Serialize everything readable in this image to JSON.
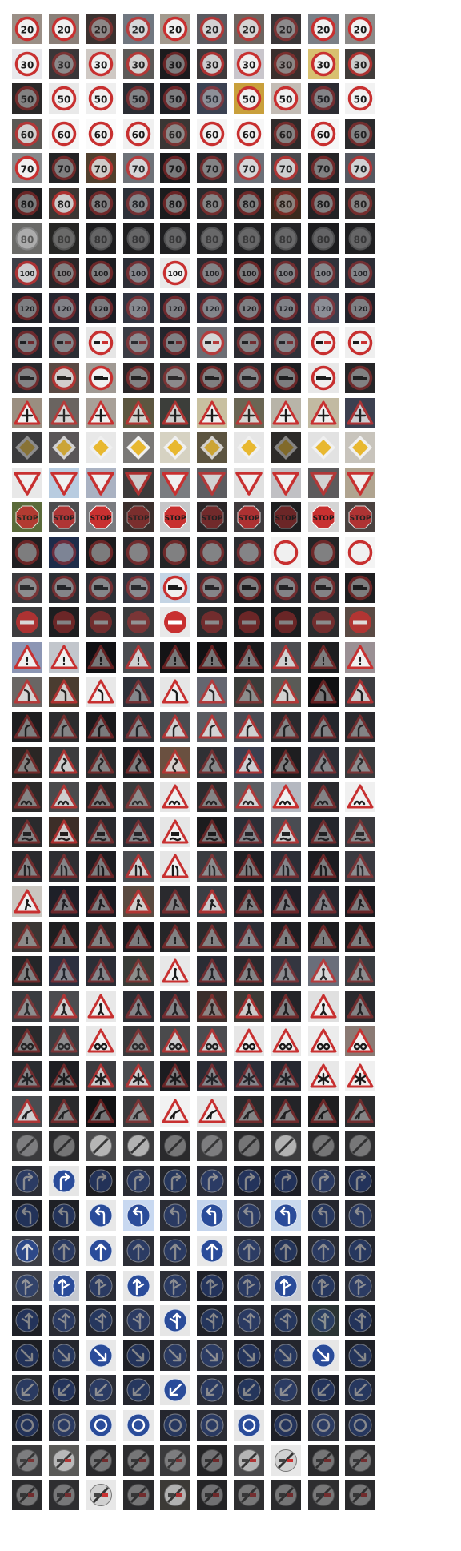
{
  "grid": {
    "columns": 10,
    "rows": [
      {
        "class": "speed-limit-20",
        "shape": "circle-red",
        "symbol": "20",
        "bgs": [
          "#9a8f86",
          "#8a7f78",
          "#3b3230",
          "#707780",
          "#a39a8e",
          "#5a5a60",
          "#6d6560",
          "#3a3638",
          "#7a7f86",
          "#8c8a88"
        ]
      },
      {
        "class": "speed-limit-30",
        "shape": "circle-red",
        "symbol": "30",
        "bgs": [
          "#e8e8ec",
          "#3a3638",
          "#cfc9c4",
          "#5c5a58",
          "#1c1b1d",
          "#3e3a3c",
          "#c9c6cc",
          "#3a2e2c",
          "#d8c070",
          "#403c3a"
        ]
      },
      {
        "class": "speed-limit-50",
        "shape": "circle-red",
        "symbol": "50",
        "bgs": [
          "#2a2828",
          "#e9e9e9",
          "#efefef",
          "#2a2d33",
          "#1e1f24",
          "#3b4252",
          "#c9a03c",
          "#c3bcb5",
          "#2c2c32",
          "#f2f2f2"
        ]
      },
      {
        "class": "speed-limit-60",
        "shape": "circle-red",
        "symbol": "60",
        "bgs": [
          "#5a5854",
          "#f5f5f5",
          "#fafafa",
          "#f0f0f0",
          "#3a3634",
          "#f4f4f4",
          "#f7f7f7",
          "#2e2a2a",
          "#f6f6f6",
          "#2a2a2c"
        ]
      },
      {
        "class": "speed-limit-70",
        "shape": "circle-red",
        "symbol": "70",
        "bgs": [
          "#888a8c",
          "#242426",
          "#51402e",
          "#6e7278",
          "#1a1a1c",
          "#2a2a2e",
          "#6c7078",
          "#4a4a4e",
          "#262628",
          "#555860"
        ]
      },
      {
        "class": "speed-limit-80",
        "shape": "circle-red",
        "symbol": "80",
        "bgs": [
          "#1d1d1f",
          "#3c3633",
          "#262325",
          "#2c3038",
          "#1b1b1d",
          "#2b2b2e",
          "#232325",
          "#3a2a1e",
          "#222224",
          "#2f2c2c"
        ]
      },
      {
        "class": "end-speed-limit-80",
        "shape": "circle-gray",
        "symbol": "80",
        "bgs": [
          "#6a6a68",
          "#262624",
          "#1d1d1f",
          "#1e1e20",
          "#1f1f21",
          "#222224",
          "#202022",
          "#232325",
          "#1c1c1e",
          "#1f1f21"
        ]
      },
      {
        "class": "speed-limit-100",
        "shape": "circle-red",
        "symbol": "100",
        "bgs": [
          "#3c3e46",
          "#2a2628",
          "#1e1e22",
          "#2c2e36",
          "#e9e9e9",
          "#2a2a30",
          "#1d1d21",
          "#2a2a30",
          "#30323a",
          "#2c2d35"
        ]
      },
      {
        "class": "speed-limit-120",
        "shape": "circle-red",
        "symbol": "120",
        "bgs": [
          "#1f2026",
          "#262630",
          "#1c1d24",
          "#323642",
          "#24252d",
          "#2a2d38",
          "#202128",
          "#252631",
          "#3a3e4c",
          "#22232a"
        ]
      },
      {
        "class": "no-passing",
        "shape": "circle-red",
        "symbol": "bars",
        "bgs": [
          "#23252c",
          "#2c2e34",
          "#e6e6e6",
          "#3a3c44",
          "#24252c",
          "#6c6e74",
          "#2a2b31",
          "#2f3138",
          "#f1f1f1",
          "#efefef"
        ]
      },
      {
        "class": "no-passing-trucks",
        "shape": "circle-red",
        "symbol": "truck",
        "bgs": [
          "#2a2a2e",
          "#5a4a44",
          "#a09a94",
          "#2a2628",
          "#3a3638",
          "#242426",
          "#2c2c30",
          "#1e1e22",
          "#e8e8e8",
          "#262628"
        ]
      },
      {
        "class": "right-of-way",
        "shape": "triangle",
        "symbol": "cross",
        "bgs": [
          "#9a8e80",
          "#6a6460",
          "#a8a098",
          "#5c5640",
          "#3c3e3a",
          "#c8c0a0",
          "#6a6654",
          "#b8b4a8",
          "#c2baa2",
          "#3c4050"
        ]
      },
      {
        "class": "priority-road",
        "shape": "diamond",
        "symbol": "",
        "bgs": [
          "#3a3a3c",
          "#5a5658",
          "#e8e8e8",
          "#7a7876",
          "#d6d2c2",
          "#5c5440",
          "#e6e6e6",
          "#2c2a28",
          "#e2e2e2",
          "#c8c4bc"
        ]
      },
      {
        "class": "yield",
        "shape": "triangle-down",
        "symbol": "",
        "bgs": [
          "#e8e8e8",
          "#b8cce0",
          "#aab2c2",
          "#3c3a3a",
          "#7a7c80",
          "#5c5c60",
          "#e0e0e0",
          "#c0c0c4",
          "#5c5a5c",
          "#b0a490"
        ]
      },
      {
        "class": "stop",
        "shape": "octagon",
        "symbol": "STOP",
        "bgs": [
          "#5a6a3a",
          "#4c4c4e",
          "#7a7c80",
          "#3a2e2c",
          "#c6c6c8",
          "#2a2628",
          "#3e3a3c",
          "#1e1e20",
          "#d4d4d4",
          "#4a4240"
        ]
      },
      {
        "class": "no-vehicles",
        "shape": "circle-ring",
        "symbol": "",
        "bgs": [
          "#1f1f21",
          "#1e2c4a",
          "#1c1c1e",
          "#2a2a2e",
          "#242426",
          "#282a2e",
          "#2c2c30",
          "#f2f2f2",
          "#242426",
          "#f4f4f4"
        ]
      },
      {
        "class": "no-heavy-vehicles",
        "shape": "circle-red",
        "symbol": "truck",
        "bgs": [
          "#3a3a3e",
          "#2c2e34",
          "#2e3036",
          "#343640",
          "#c4d4e4",
          "#2e2e34",
          "#1e1e22",
          "#2a2a30",
          "#2a2a2e",
          "#1e1e20"
        ]
      },
      {
        "class": "no-entry",
        "shape": "no-entry",
        "symbol": "",
        "bgs": [
          "#3c3c3e",
          "#1e1e20",
          "#2a2a2c",
          "#3a3a3c",
          "#e8e8e8",
          "#2a2a2c",
          "#1e1e20",
          "#1c1c1e",
          "#2c2c2e",
          "#5a4a44"
        ]
      },
      {
        "class": "general-caution",
        "shape": "triangle",
        "symbol": "!",
        "bgs": [
          "#8c96b4",
          "#c2c6cc",
          "#111114",
          "#4a4c50",
          "#141416",
          "#121214",
          "#1a1a1c",
          "#4c4c50",
          "#1e1e20",
          "#9a9094"
        ]
      },
      {
        "class": "dangerous-curve-left",
        "shape": "triangle",
        "symbol": "curveL",
        "bgs": [
          "#6a6664",
          "#4a3c30",
          "#e8e8e8",
          "#2e3038",
          "#e6e6e6",
          "#646670",
          "#3a3c3a",
          "#5a5a56",
          "#111113",
          "#3c3c40"
        ]
      },
      {
        "class": "dangerous-curve-right",
        "shape": "triangle",
        "symbol": "curveR",
        "bgs": [
          "#1e1e20",
          "#2c2c2e",
          "#1a1a1c",
          "#2c2e34",
          "#4a4c50",
          "#5a5c62",
          "#4a4c54",
          "#2a2a2e",
          "#24262c",
          "#2a2a2e"
        ]
      },
      {
        "class": "double-curve",
        "shape": "triangle",
        "symbol": "curveS",
        "bgs": [
          "#2a2624",
          "#3c3c3e",
          "#2a2a2c",
          "#1e1e22",
          "#6a5040",
          "#303034",
          "#3c4050",
          "#1e1e20",
          "#2c2e36",
          "#3a3a3c"
        ]
      },
      {
        "class": "bumpy-road",
        "shape": "triangle",
        "symbol": "bump",
        "bgs": [
          "#2c2a2a",
          "#4a4a4c",
          "#262628",
          "#3a3a3c",
          "#e6e6e6",
          "#2c2c2e",
          "#5a5c60",
          "#b4b8c0",
          "#2a2a2e",
          "#f0f0f0"
        ]
      },
      {
        "class": "slippery-road",
        "shape": "triangle",
        "symbol": "car",
        "bgs": [
          "#2a2a2c",
          "#3c2e28",
          "#2a2a2e",
          "#2c2e34",
          "#e6e6e6",
          "#1c1c1e",
          "#2c2e36",
          "#4a4c52",
          "#24262c",
          "#3a3a3e"
        ]
      },
      {
        "class": "road-narrows-right",
        "shape": "triangle",
        "symbol": "narrow",
        "bgs": [
          "#2a2a2e",
          "#2e2e32",
          "#1e1e22",
          "#4a4c50",
          "#e6e6e6",
          "#3a3c40",
          "#202024",
          "#2c2e36",
          "#1c1c20",
          "#3a3a40"
        ]
      },
      {
        "class": "road-work",
        "shape": "triangle",
        "symbol": "worker",
        "bgs": [
          "#cac6c0",
          "#1e2028",
          "#1c1c22",
          "#5a4a40",
          "#2a2a2e",
          "#3c3e44",
          "#242428",
          "#202028",
          "#262830",
          "#1c1c20"
        ]
      },
      {
        "class": "traffic-signals",
        "shape": "triangle",
        "symbol": "!",
        "bgs": [
          "#3a3634",
          "#1e1e20",
          "#262628",
          "#1c1c20",
          "#262628",
          "#2a2a2c",
          "#2c2e36",
          "#1e1e22",
          "#1c1c1e",
          "#1e1e20"
        ]
      },
      {
        "class": "pedestrians",
        "shape": "triangle",
        "symbol": "person",
        "bgs": [
          "#242628",
          "#2c3040",
          "#2c2e36",
          "#3a3c38",
          "#e8e8e8",
          "#2a2c34",
          "#2a2a2e",
          "#343640",
          "#6a6e7a",
          "#3a3c40"
        ]
      },
      {
        "class": "children-crossing",
        "shape": "triangle",
        "symbol": "person",
        "bgs": [
          "#3a3c40",
          "#4c4c50",
          "#e8e8e8",
          "#2c2e34",
          "#2a2a30",
          "#3a2e2c",
          "#3c3a36",
          "#242428",
          "#e0e0e0",
          "#2a2a2e"
        ]
      },
      {
        "class": "bicycles-crossing",
        "shape": "triangle",
        "symbol": "bike",
        "bgs": [
          "#2a2a2c",
          "#3a3c40",
          "#e8e8e8",
          "#3a3a3c",
          "#4a4a4c",
          "#4c4c50",
          "#e6e6e6",
          "#e8e8e8",
          "#ececec",
          "#8a7a74"
        ]
      },
      {
        "class": "snow-ice",
        "shape": "triangle",
        "symbol": "snow",
        "bgs": [
          "#2a2c30",
          "#1e1e22",
          "#3c3c40",
          "#4a4c50",
          "#1c1c20",
          "#2a2c34",
          "#2c2e38",
          "#262830",
          "#e8e8e8",
          "#f0f0f0"
        ]
      },
      {
        "class": "wild-animals",
        "shape": "triangle",
        "symbol": "deer",
        "bgs": [
          "#4a4c50",
          "#2a2a2c",
          "#121214",
          "#3a3a3c",
          "#f2f2f2",
          "#e6e6e6",
          "#2a2a2c",
          "#242428",
          "#1e1e20",
          "#2c2c2e"
        ]
      },
      {
        "class": "end-limits",
        "shape": "end",
        "symbol": "",
        "bgs": [
          "#3a3a3c",
          "#2a2a2c",
          "#4a4a4c",
          "#3c3c3e",
          "#2a2a2c",
          "#3a3a3c",
          "#2a2a2c",
          "#3c3c3e",
          "#2a2a2c",
          "#2e2e30"
        ]
      },
      {
        "class": "turn-right-ahead",
        "shape": "circle-blue",
        "symbol": "turnR",
        "bgs": [
          "#2c2e36",
          "#e6e6e6",
          "#1e1e22",
          "#2a2c34",
          "#24262c",
          "#2c2e38",
          "#1e2028",
          "#1c1e26",
          "#2a2c34",
          "#1e2028"
        ]
      },
      {
        "class": "turn-left-ahead",
        "shape": "circle-blue",
        "symbol": "turnL",
        "bgs": [
          "#1c1e24",
          "#1e2026",
          "#e8e8e8",
          "#c8d8f0",
          "#2a2c34",
          "#c4d4ec",
          "#2c2e38",
          "#c8d8ec",
          "#24262e",
          "#2a2c34"
        ]
      },
      {
        "class": "ahead-only",
        "shape": "circle-blue",
        "symbol": "up",
        "bgs": [
          "#3c3e46",
          "#2a2c34",
          "#e6e6e6",
          "#2c2e36",
          "#2a2c34",
          "#e8e8e8",
          "#2e3038",
          "#202228",
          "#2a2c34",
          "#24262e"
        ]
      },
      {
        "class": "straight-or-right",
        "shape": "circle-blue",
        "symbol": "upR",
        "bgs": [
          "#3a3c44",
          "#c4c8d0",
          "#2a2c34",
          "#e6e6e6",
          "#2c2e36",
          "#1e2028",
          "#2a2c34",
          "#c8ccd4",
          "#24262e",
          "#2c2e36"
        ]
      },
      {
        "class": "straight-or-left",
        "shape": "circle-blue",
        "symbol": "upL",
        "bgs": [
          "#1e2026",
          "#2a2c34",
          "#24262e",
          "#2c2e36",
          "#e6e6e6",
          "#202228",
          "#2a2c34",
          "#24262e",
          "#2a3434",
          "#1e2026"
        ]
      },
      {
        "class": "keep-right",
        "shape": "circle-blue",
        "symbol": "downR",
        "bgs": [
          "#1c1e24",
          "#24262e",
          "#e8e8e8",
          "#1e2026",
          "#2a2c34",
          "#2c2e36",
          "#1e2028",
          "#24262e",
          "#e6e6e6",
          "#1e2026"
        ]
      },
      {
        "class": "keep-left",
        "shape": "circle-blue",
        "symbol": "downL",
        "bgs": [
          "#2a2c30",
          "#1e2028",
          "#2c2e36",
          "#24262e",
          "#e6e6e6",
          "#2a2c34",
          "#202228",
          "#2c2e36",
          "#1e2028",
          "#24262e"
        ]
      },
      {
        "class": "roundabout",
        "shape": "circle-blue",
        "symbol": "round",
        "bgs": [
          "#1c1e24",
          "#2a2c34",
          "#e6e6e6",
          "#e8e8e8",
          "#24262e",
          "#2a2c34",
          "#e6e6e6",
          "#1e2028",
          "#2c2e36",
          "#24262e"
        ]
      },
      {
        "class": "end-no-passing",
        "shape": "end",
        "symbol": "bars",
        "bgs": [
          "#3a3a3c",
          "#5a5a58",
          "#2a2a2c",
          "#2c2c2e",
          "#3a3a3c",
          "#242426",
          "#4a4a4c",
          "#e8e8e8",
          "#2a2a2c",
          "#2e2e30"
        ]
      },
      {
        "class": "end-no-passing-trucks",
        "shape": "end",
        "symbol": "bars",
        "bgs": [
          "#2a2a2c",
          "#2e2e30",
          "#e8e8e8",
          "#2a2a2c",
          "#3c3a36",
          "#242426",
          "#2e2e30",
          "#2a2a2c",
          "#2e2e30",
          "#2a2a2c"
        ]
      }
    ]
  },
  "colors": {
    "red": "#c83030",
    "blue": "#2a4c9a",
    "white": "#f0f0f0",
    "yellow": "#e8b830",
    "dark": "#1a1a1a"
  }
}
